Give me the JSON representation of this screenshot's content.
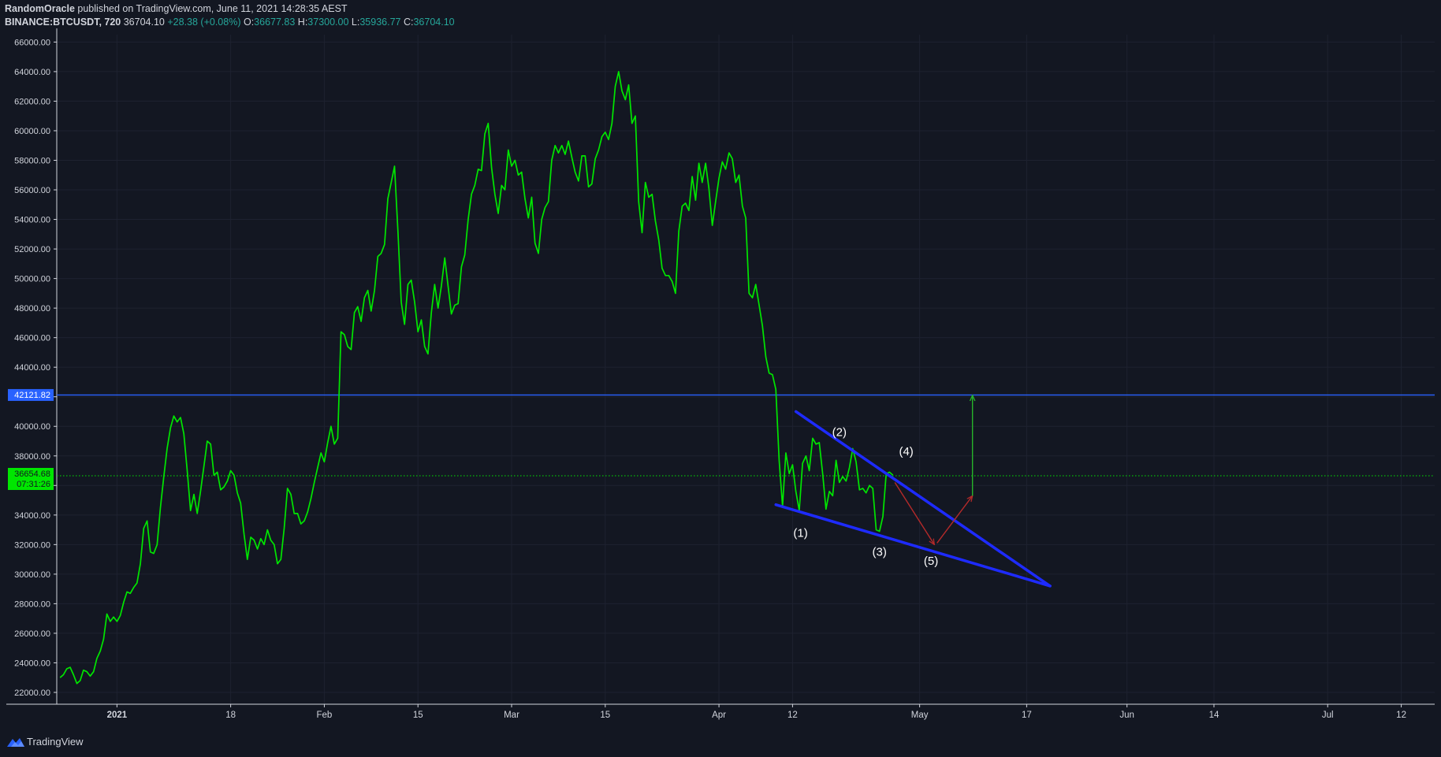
{
  "header": {
    "author": "RandomOracle",
    "published_text": "published on TradingView.com, June 11, 2021 14:28:35 AEST",
    "symbol": "BINANCE:BTCUSDT, 720",
    "last_price": "36704.10",
    "change": "+28.38 (+0.08%)",
    "o_label": "O:",
    "o_value": "36677.83",
    "h_label": "H:",
    "h_value": "37300.00",
    "l_label": "L:",
    "l_value": "35936.77",
    "c_label": "C:",
    "c_value": "36704.10"
  },
  "footer": {
    "brand": "TradingView"
  },
  "chart_data": {
    "type": "line",
    "ylim": [
      21200,
      66500
    ],
    "x_range_days": [
      -9,
      197
    ],
    "y_tick_labels": [
      "22000.00",
      "24000.00",
      "26000.00",
      "28000.00",
      "30000.00",
      "32000.00",
      "34000.00",
      "36000.00",
      "38000.00",
      "40000.00",
      "42000.00",
      "44000.00",
      "46000.00",
      "48000.00",
      "50000.00",
      "52000.00",
      "54000.00",
      "56000.00",
      "58000.00",
      "60000.00",
      "62000.00",
      "64000.00",
      "66000.00"
    ],
    "y_tick_values": [
      22000,
      24000,
      26000,
      28000,
      30000,
      32000,
      34000,
      36000,
      38000,
      40000,
      42000,
      44000,
      46000,
      48000,
      50000,
      52000,
      54000,
      56000,
      58000,
      60000,
      62000,
      64000,
      66000
    ],
    "x_ticks": [
      {
        "label": "2021",
        "day": 0,
        "bold": true
      },
      {
        "label": "18",
        "day": 17
      },
      {
        "label": "Feb",
        "day": 31
      },
      {
        "label": "15",
        "day": 45
      },
      {
        "label": "Mar",
        "day": 59
      },
      {
        "label": "15",
        "day": 73
      },
      {
        "label": "Apr",
        "day": 90
      },
      {
        "label": "12",
        "day": 101
      },
      {
        "label": "May",
        "day": 120
      },
      {
        "label": "17",
        "day": 136
      },
      {
        "label": "Jun",
        "day": 151
      },
      {
        "label": "14",
        "day": 164
      },
      {
        "label": "Jul",
        "day": 181
      },
      {
        "label": "12",
        "day": 192
      }
    ],
    "series": [
      {
        "color": "#00e600",
        "points": [
          [
            -8.5,
            23000
          ],
          [
            -8,
            23200
          ],
          [
            -7.5,
            23600
          ],
          [
            -7,
            23700
          ],
          [
            -6.5,
            23200
          ],
          [
            -6,
            22600
          ],
          [
            -5.5,
            22800
          ],
          [
            -5,
            23500
          ],
          [
            -4.5,
            23400
          ],
          [
            -4,
            23100
          ],
          [
            -3.5,
            23400
          ],
          [
            -3,
            24300
          ],
          [
            -2.5,
            24800
          ],
          [
            -2,
            25600
          ],
          [
            -1.5,
            27300
          ],
          [
            -1,
            26800
          ],
          [
            -0.5,
            27100
          ],
          [
            0,
            26800
          ],
          [
            0.5,
            27200
          ],
          [
            1,
            28100
          ],
          [
            1.5,
            28800
          ],
          [
            2,
            28700
          ],
          [
            2.5,
            29100
          ],
          [
            3,
            29400
          ],
          [
            3.5,
            30700
          ],
          [
            4,
            33100
          ],
          [
            4.5,
            33600
          ],
          [
            5,
            31500
          ],
          [
            5.5,
            31400
          ],
          [
            6,
            32000
          ],
          [
            6.5,
            34500
          ],
          [
            7,
            36600
          ],
          [
            7.5,
            38500
          ],
          [
            8,
            39900
          ],
          [
            8.5,
            40700
          ],
          [
            9,
            40300
          ],
          [
            9.5,
            40600
          ],
          [
            10,
            39500
          ],
          [
            10.5,
            37000
          ],
          [
            11,
            34300
          ],
          [
            11.5,
            35400
          ],
          [
            12,
            34100
          ],
          [
            12.5,
            35600
          ],
          [
            13,
            37300
          ],
          [
            13.5,
            39000
          ],
          [
            14,
            38800
          ],
          [
            14.5,
            36700
          ],
          [
            15,
            36900
          ],
          [
            15.5,
            35700
          ],
          [
            16,
            35900
          ],
          [
            16.5,
            36300
          ],
          [
            17,
            37000
          ],
          [
            17.5,
            36700
          ],
          [
            18,
            35500
          ],
          [
            18.5,
            34800
          ],
          [
            19,
            32700
          ],
          [
            19.5,
            31000
          ],
          [
            20,
            32500
          ],
          [
            20.5,
            32300
          ],
          [
            21,
            31700
          ],
          [
            21.5,
            32400
          ],
          [
            22,
            32000
          ],
          [
            22.5,
            33000
          ],
          [
            23,
            32300
          ],
          [
            23.5,
            32000
          ],
          [
            24,
            30700
          ],
          [
            24.5,
            31000
          ],
          [
            25,
            33100
          ],
          [
            25.5,
            35800
          ],
          [
            26,
            35400
          ],
          [
            26.5,
            34100
          ],
          [
            27,
            34100
          ],
          [
            27.5,
            33400
          ],
          [
            28,
            33600
          ],
          [
            28.5,
            34200
          ],
          [
            29,
            35100
          ],
          [
            29.5,
            36200
          ],
          [
            30,
            37200
          ],
          [
            30.5,
            38200
          ],
          [
            31,
            37600
          ],
          [
            31.5,
            38900
          ],
          [
            32,
            40000
          ],
          [
            32.5,
            38800
          ],
          [
            33,
            39200
          ],
          [
            33.5,
            46400
          ],
          [
            34,
            46200
          ],
          [
            34.5,
            45400
          ],
          [
            35,
            45200
          ],
          [
            35.5,
            47700
          ],
          [
            36,
            48100
          ],
          [
            36.5,
            47100
          ],
          [
            37,
            48700
          ],
          [
            37.5,
            49200
          ],
          [
            38,
            47800
          ],
          [
            38.5,
            49200
          ],
          [
            39,
            51500
          ],
          [
            39.5,
            51700
          ],
          [
            40,
            52300
          ],
          [
            40.5,
            55400
          ],
          [
            41,
            56500
          ],
          [
            41.5,
            57600
          ],
          [
            42,
            53200
          ],
          [
            42.5,
            48400
          ],
          [
            43,
            46900
          ],
          [
            43.5,
            49600
          ],
          [
            44,
            49900
          ],
          [
            44.5,
            48400
          ],
          [
            45,
            46400
          ],
          [
            45.5,
            47200
          ],
          [
            46,
            45400
          ],
          [
            46.5,
            44900
          ],
          [
            47,
            47700
          ],
          [
            47.5,
            49600
          ],
          [
            48,
            48000
          ],
          [
            48.5,
            49500
          ],
          [
            49,
            51400
          ],
          [
            49.5,
            49500
          ],
          [
            50,
            47600
          ],
          [
            50.5,
            48200
          ],
          [
            51,
            48300
          ],
          [
            51.5,
            50800
          ],
          [
            52,
            51600
          ],
          [
            52.5,
            54000
          ],
          [
            53,
            55700
          ],
          [
            53.5,
            56300
          ],
          [
            54,
            57400
          ],
          [
            54.5,
            57300
          ],
          [
            55,
            59800
          ],
          [
            55.5,
            60500
          ],
          [
            56,
            57500
          ],
          [
            56.5,
            55700
          ],
          [
            57,
            54400
          ],
          [
            57.5,
            56300
          ],
          [
            58,
            56000
          ],
          [
            58.5,
            58700
          ],
          [
            59,
            57600
          ],
          [
            59.5,
            58000
          ],
          [
            60,
            57000
          ],
          [
            60.5,
            57200
          ],
          [
            61,
            55400
          ],
          [
            61.5,
            54100
          ],
          [
            62,
            55500
          ],
          [
            62.5,
            52400
          ],
          [
            63,
            51700
          ],
          [
            63.5,
            54000
          ],
          [
            64,
            54800
          ],
          [
            64.5,
            55200
          ],
          [
            65,
            58000
          ],
          [
            65.5,
            59000
          ],
          [
            66,
            58500
          ],
          [
            66.5,
            59000
          ],
          [
            67,
            58400
          ],
          [
            67.5,
            59300
          ],
          [
            68,
            58200
          ],
          [
            68.5,
            57200
          ],
          [
            69,
            56600
          ],
          [
            69.5,
            58300
          ],
          [
            70,
            58300
          ],
          [
            70.5,
            56200
          ],
          [
            71,
            56400
          ],
          [
            71.5,
            58100
          ],
          [
            72,
            58700
          ],
          [
            72.5,
            59600
          ],
          [
            73,
            59900
          ],
          [
            73.5,
            59400
          ],
          [
            74,
            60500
          ],
          [
            74.5,
            63000
          ],
          [
            75,
            64000
          ],
          [
            75.5,
            62700
          ],
          [
            76,
            62100
          ],
          [
            76.5,
            63100
          ],
          [
            77,
            60500
          ],
          [
            77.5,
            61000
          ],
          [
            78,
            55200
          ],
          [
            78.5,
            53100
          ],
          [
            79,
            56500
          ],
          [
            79.5,
            55500
          ],
          [
            80,
            55700
          ],
          [
            80.5,
            53900
          ],
          [
            81,
            52600
          ],
          [
            81.5,
            50700
          ],
          [
            82,
            50200
          ],
          [
            82.5,
            50200
          ],
          [
            83,
            49800
          ],
          [
            83.5,
            49000
          ],
          [
            84,
            53200
          ],
          [
            84.5,
            54900
          ],
          [
            85,
            55100
          ],
          [
            85.5,
            54600
          ],
          [
            86,
            56900
          ],
          [
            86.5,
            55300
          ],
          [
            87,
            57800
          ],
          [
            87.5,
            56500
          ],
          [
            88,
            57800
          ],
          [
            88.5,
            56100
          ],
          [
            89,
            53600
          ],
          [
            89.5,
            55200
          ],
          [
            90,
            56800
          ],
          [
            90.5,
            57900
          ],
          [
            91,
            57400
          ],
          [
            91.5,
            58500
          ],
          [
            92,
            58100
          ],
          [
            92.5,
            56500
          ],
          [
            93,
            57000
          ],
          [
            93.5,
            54900
          ],
          [
            94,
            54100
          ],
          [
            94.5,
            49000
          ],
          [
            95,
            48700
          ],
          [
            95.5,
            49600
          ],
          [
            96,
            48200
          ],
          [
            96.5,
            46800
          ],
          [
            97,
            44700
          ],
          [
            97.5,
            43600
          ],
          [
            98,
            43500
          ],
          [
            98.5,
            42500
          ],
          [
            99,
            37700
          ],
          [
            99.5,
            34600
          ],
          [
            100,
            38200
          ],
          [
            100.5,
            36800
          ],
          [
            101,
            37400
          ],
          [
            101.5,
            35600
          ],
          [
            102,
            34300
          ],
          [
            102.5,
            37500
          ],
          [
            103,
            38000
          ],
          [
            103.5,
            37000
          ],
          [
            104,
            39200
          ],
          [
            104.5,
            38800
          ],
          [
            105,
            38900
          ],
          [
            105.5,
            36800
          ],
          [
            106,
            34400
          ],
          [
            106.5,
            35600
          ],
          [
            107,
            35300
          ],
          [
            107.5,
            37700
          ],
          [
            108,
            36200
          ],
          [
            108.5,
            36600
          ],
          [
            109,
            36300
          ],
          [
            109.5,
            37200
          ],
          [
            110,
            38500
          ],
          [
            110.5,
            37600
          ],
          [
            111,
            35700
          ],
          [
            111.5,
            35800
          ],
          [
            112,
            35500
          ],
          [
            112.5,
            36000
          ],
          [
            113,
            35800
          ],
          [
            113.5,
            33000
          ],
          [
            114,
            32900
          ],
          [
            114.5,
            33900
          ],
          [
            115,
            36800
          ],
          [
            115.5,
            36900
          ],
          [
            116,
            36700
          ]
        ]
      }
    ],
    "horizontal_lines": [
      {
        "value": 42121.82,
        "label": "42121.82",
        "color": "#2962ff",
        "style": "solid"
      },
      {
        "value": 36654.68,
        "label": "36654.68",
        "countdown": "07:31:26",
        "color": "#00e600",
        "style": "dotted"
      }
    ],
    "annotations": {
      "trendlines": [
        {
          "from": [
            101.5,
            41000
          ],
          "to": [
            139.5,
            29200
          ],
          "color": "#1e2bff"
        },
        {
          "from": [
            98.5,
            34700
          ],
          "to": [
            139.5,
            29200
          ],
          "color": "#1e2bff"
        }
      ],
      "arrows": [
        {
          "from": [
            116.3,
            36200
          ],
          "to": [
            122.2,
            32000
          ],
          "color": "#b52a2a"
        },
        {
          "from": [
            122.6,
            32100
          ],
          "to": [
            127.9,
            35300
          ],
          "color": "#b52a2a"
        },
        {
          "from": [
            127.9,
            35300
          ],
          "to": [
            127.9,
            42100
          ],
          "color": "#27b42a"
        }
      ],
      "wave_labels": [
        {
          "text": "(1)",
          "day": 102.2,
          "value": 32800
        },
        {
          "text": "(2)",
          "day": 108.0,
          "value": 39600
        },
        {
          "text": "(3)",
          "day": 114.0,
          "value": 31500
        },
        {
          "text": "(4)",
          "day": 118.0,
          "value": 38300
        },
        {
          "text": "(5)",
          "day": 121.7,
          "value": 30900
        }
      ]
    }
  }
}
